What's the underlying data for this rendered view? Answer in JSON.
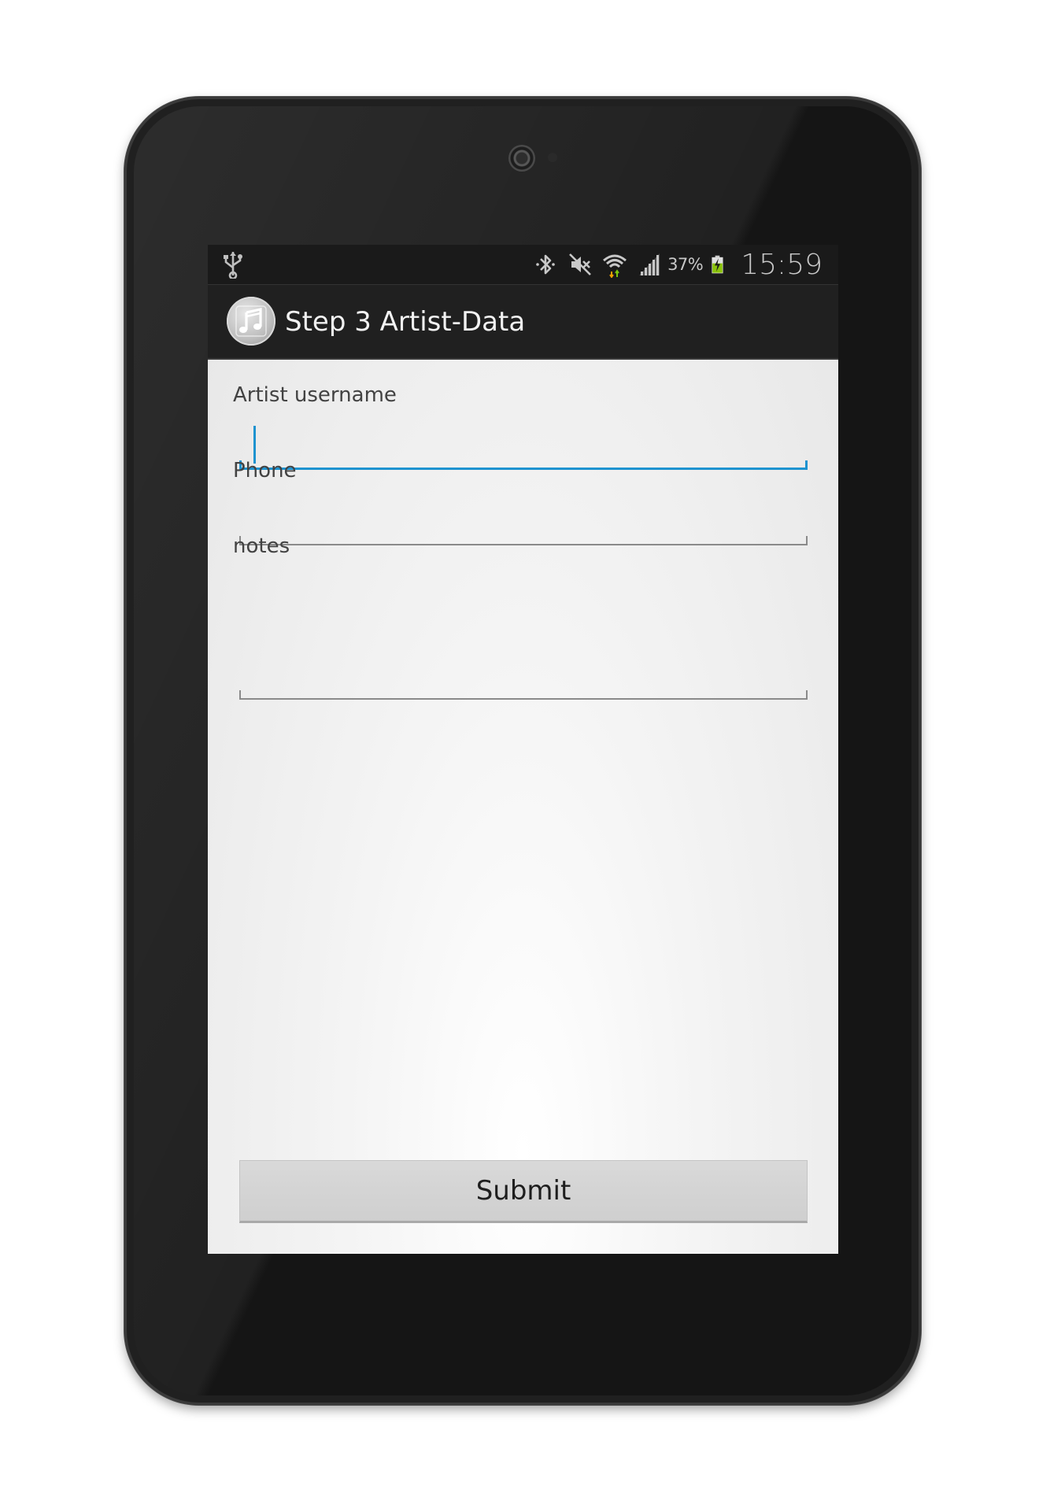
{
  "status_bar": {
    "battery_percent": "37%",
    "clock": "15:59",
    "icons": [
      "usb-icon",
      "bluetooth-icon",
      "mute-icon",
      "wifi-icon",
      "signal-icon",
      "battery-charging-icon"
    ]
  },
  "action_bar": {
    "app_icon": "music-note-icon",
    "title": "Step 3 Artist-Data"
  },
  "form": {
    "username": {
      "label": "Artist username",
      "value": "",
      "focused": true
    },
    "phone": {
      "label": "Phone",
      "value": ""
    },
    "notes": {
      "label": "notes",
      "value": ""
    },
    "submit_label": "Submit"
  },
  "colors": {
    "accent": "#1e93d0",
    "action_bar": "#202020",
    "status_bar": "#1a1a1a",
    "screen_background": "#efefef"
  }
}
